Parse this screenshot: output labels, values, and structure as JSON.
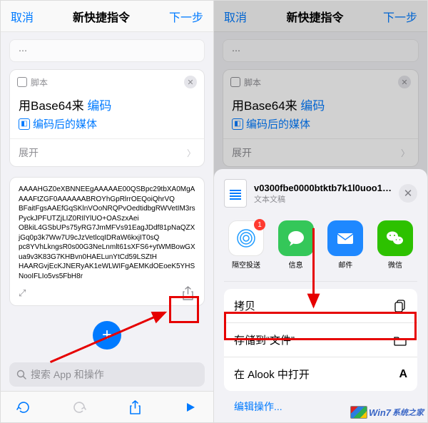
{
  "nav": {
    "cancel": "取消",
    "title": "新快捷指令",
    "next": "下一步"
  },
  "script": {
    "header": "脚本",
    "line_prefix": "用Base64来",
    "line_token": "编码",
    "media": "编码后的媒体",
    "expand": "展开"
  },
  "result_text": "AAAAHGZ0eXBNNEEgAAAAAE00QSBpc29tbXA0MgAAAAFtZGF0AAAAAABROYhGpRlrrOEQoiQhrVQ\nBFaitFgsAAEfGqSKlnVOoNRQPvOedtidbgRWVetIM3rsPyckJPFUTZjLIZ0RIlYlUO+OASzxAei\nOBkiL4GSbUPs75yRG7JmMFVs91EagJDdf81pNaQZXjGq0p3k7Ww7U9cJzVetlcqIDRaW6kxjIT0sQ\npc8YVhLkngsR0s00G3NeLnmlt61sXFS6+ytWMBowGXua9v3K83G7KHBvn0HAELunYtCd59LSZtH\nHAARGvjEcKJNERyAK1eWLWIFgAEMKdOEoeK5YHSNooIFLIo5vs5FbH8r",
  "search_placeholder": "搜索 App 和操作",
  "sheet": {
    "filename": "v0300fbe0000btktb7k1l0uoo1rrsv...",
    "subtitle": "文本文稿",
    "apps": [
      {
        "name": "隔空投送",
        "color": "#fff",
        "badge": "1"
      },
      {
        "name": "信息",
        "color": "#34c759"
      },
      {
        "name": "邮件",
        "color": "#1e88ff"
      },
      {
        "name": "微信",
        "color": "#2dc100"
      }
    ],
    "actions": [
      {
        "label": "拷贝",
        "icon": "copy"
      },
      {
        "label": "存储到“文件”",
        "icon": "folder"
      },
      {
        "label": "在 Alook 中打开",
        "icon": "A"
      }
    ],
    "edit": "编辑操作..."
  },
  "watermark": "Win7"
}
